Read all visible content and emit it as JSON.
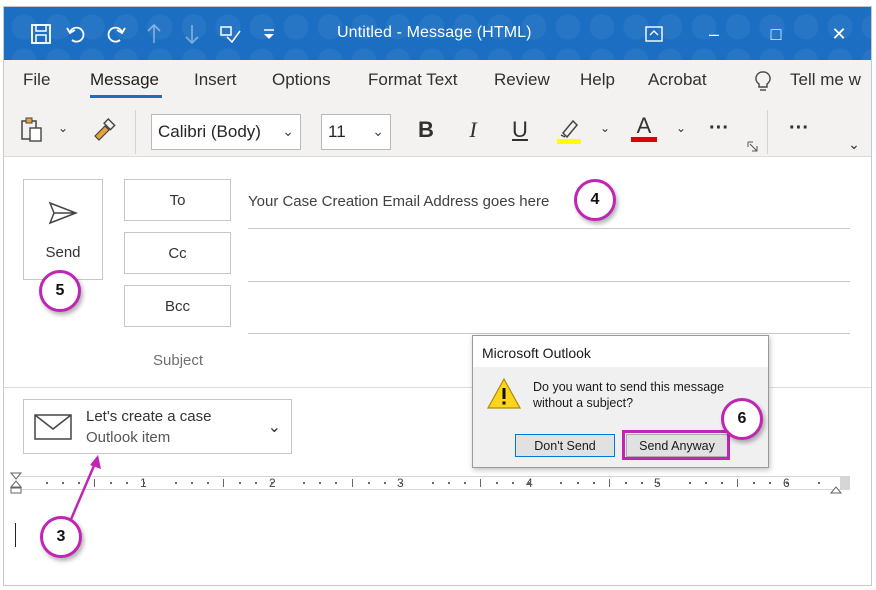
{
  "window": {
    "title": "Untitled  -  Message (HTML)",
    "accent_color": "#1b6ec2",
    "controls": {
      "restore_icon": "ribbon-display-icon",
      "minimize": "–",
      "maximize": "□",
      "close": "✕"
    }
  },
  "quick_access": [
    {
      "icon": "save-icon",
      "glyph": "💾"
    },
    {
      "icon": "undo-icon",
      "glyph": "↶"
    },
    {
      "icon": "redo-icon",
      "glyph": "↷"
    },
    {
      "icon": "up-arrow-icon",
      "glyph": "↑"
    },
    {
      "icon": "down-arrow-icon",
      "glyph": "↓"
    },
    {
      "icon": "check-names-icon",
      "glyph": "⊞"
    },
    {
      "icon": "customize-icon",
      "glyph": "▿"
    }
  ],
  "menu": {
    "items": [
      "File",
      "Message",
      "Insert",
      "Options",
      "Format Text",
      "Review",
      "Help",
      "Acrobat"
    ],
    "active": "Message",
    "tell_me": "Tell me w"
  },
  "toolbar": {
    "font_name": "Calibri (Body)",
    "font_size": "11",
    "bold": "B",
    "italic": "I",
    "underline": "U",
    "font_color_letter": "A",
    "highlight_color": "#ffff00",
    "font_color": "#e00000",
    "more": "···"
  },
  "compose": {
    "send_label": "Send",
    "to_label": "To",
    "cc_label": "Cc",
    "bcc_label": "Bcc",
    "to_value": "Your Case Creation Email Address goes here",
    "cc_value": "",
    "bcc_value": "",
    "subject_label": "Subject",
    "subject_value": ""
  },
  "addin": {
    "title": "Let's create a case",
    "subtitle": "Outlook item"
  },
  "ruler": {
    "numbers": [
      "1",
      "2",
      "3",
      "4",
      "5",
      "6"
    ]
  },
  "dialog": {
    "title": "Microsoft Outlook",
    "message": "Do you want to send this message without a subject?",
    "dont_send": "Don't Send",
    "send_anyway": "Send Anyway",
    "icon": "warning-icon"
  },
  "callouts": {
    "step3": "3",
    "step4": "4",
    "step5": "5",
    "step6": "6",
    "color": "#c026b3"
  }
}
